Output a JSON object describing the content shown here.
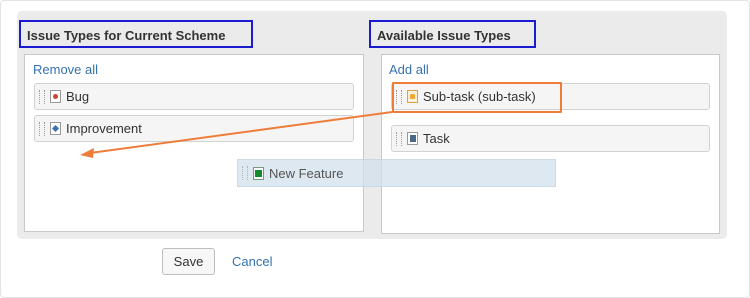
{
  "current_scheme": {
    "title": "Issue Types for Current Scheme",
    "remove_all_label": "Remove all",
    "items": [
      {
        "label": "Bug",
        "icon": "bug-icon",
        "color": "#d04437"
      },
      {
        "label": "Improvement",
        "icon": "improvement-icon",
        "color": "#3b73af"
      }
    ]
  },
  "available": {
    "title": "Available Issue Types",
    "add_all_label": "Add all",
    "items": [
      {
        "label": "Sub-task (sub-task)",
        "icon": "subtask-icon",
        "color": "#f0a830"
      },
      {
        "label": "Task",
        "icon": "task-icon",
        "color": "#4a6785"
      }
    ]
  },
  "dragging_item": {
    "label": "New Feature",
    "icon": "new-feature-icon",
    "color": "#14892c"
  },
  "annotations": {
    "highlight_color": "#ee7d3a",
    "title_border_color": "#1a1ad0"
  },
  "footer": {
    "save_label": "Save",
    "cancel_label": "Cancel"
  }
}
